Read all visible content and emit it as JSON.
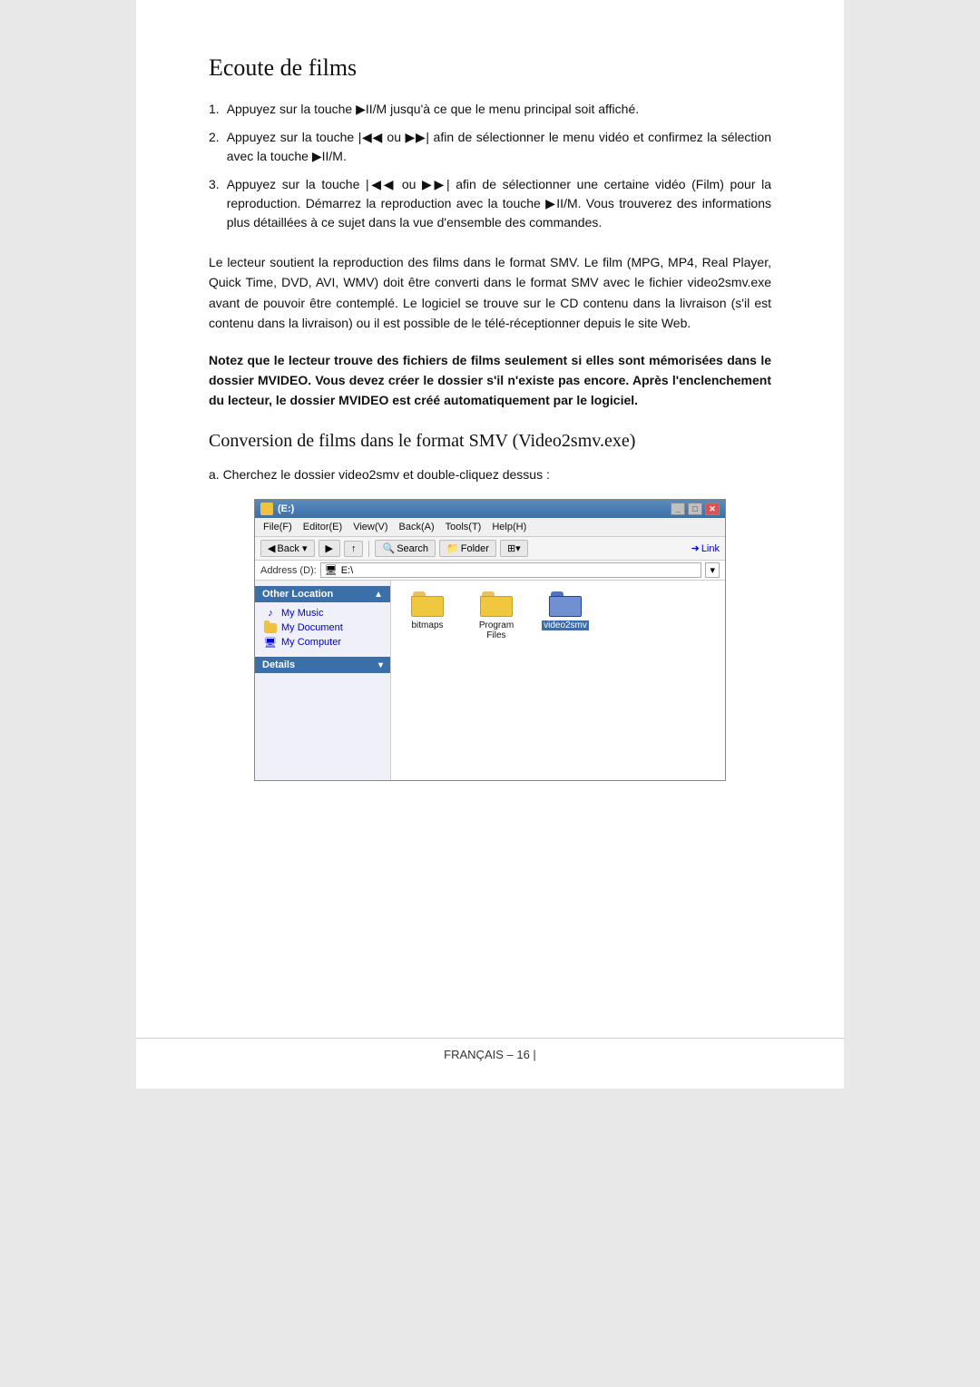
{
  "page": {
    "title": "Ecoute de films",
    "footer": "FRANÇAIS – 16 |"
  },
  "section1": {
    "title": "Ecoute de films",
    "steps": [
      {
        "num": "1.",
        "text": "Appuyez sur la touche ▶II/M jusqu'à ce que le menu principal soit affiché."
      },
      {
        "num": "2.",
        "text": "Appuyez sur la touche  |◀◀  ou  ▶▶|  afin de sélectionner le menu vidéo et confirmez la sélection avec la touche ▶II/M."
      },
      {
        "num": "3.",
        "text": "Appuyez sur la touche |◀◀ ou ▶▶| afin de sélectionner une certaine vidéo (Film) pour la reproduction. Démarrez la reproduction avec la touche ▶II/M. Vous trouverez des informations plus détaillées à ce sujet dans la vue d'ensemble des commandes."
      }
    ],
    "paragraph1": "Le lecteur soutient la reproduction des films dans le format SMV. Le film (MPG, MP4, Real Player, Quick Time, DVD, AVI, WMV) doit être converti dans le format SMV avec le fichier video2smv.exe avant de pouvoir être contemplé. Le logiciel se trouve sur le CD contenu dans la livraison (s'il est contenu dans la livraison) ou il est possible de le télé-réceptionner depuis le site Web.",
    "paragraph2": "Notez que le lecteur trouve des fichiers de films seulement si elles sont mémorisées dans le dossier MVIDEO. Vous devez créer le dossier s'il n'existe pas encore. Après l'enclenchement du lecteur, le dossier MVIDEO est créé automatiquement par le logiciel."
  },
  "section2": {
    "title": "Conversion de films dans le format SMV (Video2smv.exe)",
    "step_a": "a. Cherchez le dossier video2smv et double-cliquez dessus :"
  },
  "explorer": {
    "titlebar": {
      "label": "(E:)",
      "icon": "folder-icon"
    },
    "menubar": [
      "File(F)",
      "Editor(E)",
      "View(V)",
      "Back(A)",
      "Tools(T)",
      "Help(H)"
    ],
    "toolbar": {
      "back_label": "Back ▾",
      "search_label": "Search",
      "folder_label": "Folder",
      "grid_label": "⊞▾",
      "link_label": "Link"
    },
    "address": {
      "label": "Address (D):",
      "value": "🖥 E:\\"
    },
    "left_panel": {
      "other_location_label": "Other Location",
      "nav_items": [
        {
          "icon": "music-icon",
          "label": "My Music"
        },
        {
          "icon": "folder-icon",
          "label": "My Document"
        },
        {
          "icon": "computer-icon",
          "label": "My Computer"
        }
      ],
      "details_label": "Details"
    },
    "files": [
      {
        "name": "bitmaps",
        "selected": false
      },
      {
        "name": "Program\nFiles",
        "selected": false
      },
      {
        "name": "video2smv",
        "selected": true
      }
    ]
  }
}
